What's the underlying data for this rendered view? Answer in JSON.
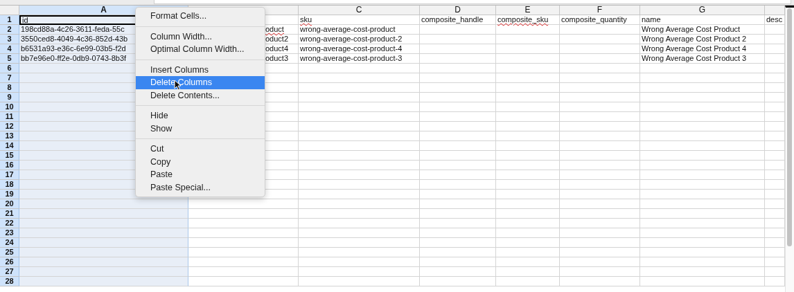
{
  "columns": [
    {
      "label": "A",
      "selected": true
    },
    {
      "selected": false
    },
    {
      "label": "C",
      "selected": false
    },
    {
      "label": "D",
      "selected": false
    },
    {
      "label": "E",
      "selected": false
    },
    {
      "label": "F",
      "selected": false
    },
    {
      "label": "G",
      "selected": false
    },
    {
      "selected": false
    }
  ],
  "rows": [
    {
      "number": "1",
      "cells": [
        {
          "text": "id",
          "misspelled": false
        },
        null,
        {
          "text": "sku",
          "misspelled": true
        },
        {
          "text": "composite_handle",
          "misspelled": false
        },
        {
          "text": "composite_sku",
          "misspelled": true
        },
        {
          "text": "composite_quantity",
          "misspelled": false
        },
        {
          "text": "name",
          "misspelled": false
        },
        {
          "text": "desc",
          "misspelled": false
        }
      ]
    },
    {
      "number": "2",
      "cells": [
        {
          "text": "198cd88a-4c26-3611-feda-55c",
          "misspelled": false
        },
        {
          "text": "oduct",
          "misspelled": true
        },
        {
          "text": "wrong-average-cost-product",
          "misspelled": false
        },
        null,
        null,
        null,
        {
          "text": "Wrong Average Cost Product",
          "misspelled": false
        },
        null
      ]
    },
    {
      "number": "3",
      "cells": [
        {
          "text": "3550ced8-4049-4c36-852d-43b",
          "misspelled": false
        },
        {
          "text": "oduct2",
          "misspelled": false
        },
        {
          "text": "wrong-average-cost-product-2",
          "misspelled": false
        },
        null,
        null,
        null,
        {
          "text": "Wrong Average Cost Product 2",
          "misspelled": false
        },
        null
      ]
    },
    {
      "number": "4",
      "cells": [
        {
          "text": "b6531a93-e36c-6e99-03b5-f2d",
          "misspelled": false
        },
        {
          "text": "oduct4",
          "misspelled": false
        },
        {
          "text": "wrong-average-cost-product-4",
          "misspelled": false
        },
        null,
        null,
        null,
        {
          "text": "Wrong Average Cost Product 4",
          "misspelled": false
        },
        null
      ]
    },
    {
      "number": "5",
      "cells": [
        {
          "text": "bb7e96e0-ff2e-0db9-0743-8b3f",
          "misspelled": false
        },
        {
          "text": "oduct3",
          "misspelled": false
        },
        {
          "text": "wrong-average-cost-product-3",
          "misspelled": false
        },
        null,
        null,
        null,
        {
          "text": "Wrong Average Cost Product 3",
          "misspelled": false
        },
        null
      ]
    },
    {
      "number": "6"
    },
    {
      "number": "7"
    },
    {
      "number": "8"
    },
    {
      "number": "9"
    },
    {
      "number": "10"
    },
    {
      "number": "11"
    },
    {
      "number": "12"
    },
    {
      "number": "13"
    },
    {
      "number": "14"
    },
    {
      "number": "15"
    },
    {
      "number": "16"
    },
    {
      "number": "17"
    },
    {
      "number": "18"
    },
    {
      "number": "19"
    },
    {
      "number": "20"
    },
    {
      "number": "21"
    },
    {
      "number": "22"
    },
    {
      "number": "23"
    },
    {
      "number": "24"
    },
    {
      "number": "25"
    },
    {
      "number": "26"
    },
    {
      "number": "27"
    },
    {
      "number": "28"
    }
  ],
  "context_menu": {
    "groups": [
      [
        {
          "label": "Format Cells...",
          "selected": false
        }
      ],
      [
        {
          "label": "Column Width...",
          "selected": false
        },
        {
          "label": "Optimal Column Width...",
          "selected": false
        }
      ],
      [
        {
          "label": "Insert Columns",
          "selected": false
        },
        {
          "label": "Delete Columns",
          "selected": true
        },
        {
          "label": "Delete Contents...",
          "selected": false
        }
      ],
      [
        {
          "label": "Hide",
          "selected": false
        },
        {
          "label": "Show",
          "selected": false
        }
      ],
      [
        {
          "label": "Cut",
          "selected": false
        },
        {
          "label": "Copy",
          "selected": false
        },
        {
          "label": "Paste",
          "selected": false
        },
        {
          "label": "Paste Special...",
          "selected": false
        }
      ]
    ]
  }
}
